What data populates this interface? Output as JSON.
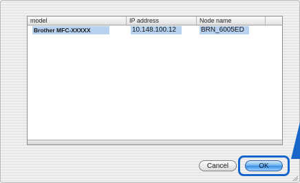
{
  "table": {
    "columns": [
      "model",
      "IP address",
      "Node name"
    ],
    "rows": [
      {
        "model": "Brother MFC-XXXXX",
        "ip": "10.148.100.12",
        "node": "BRN_6005ED"
      }
    ]
  },
  "buttons": {
    "cancel": "Cancel",
    "ok": "OK"
  },
  "colors": {
    "selection": "#b7d2f0",
    "highlight": "#1566c8"
  }
}
